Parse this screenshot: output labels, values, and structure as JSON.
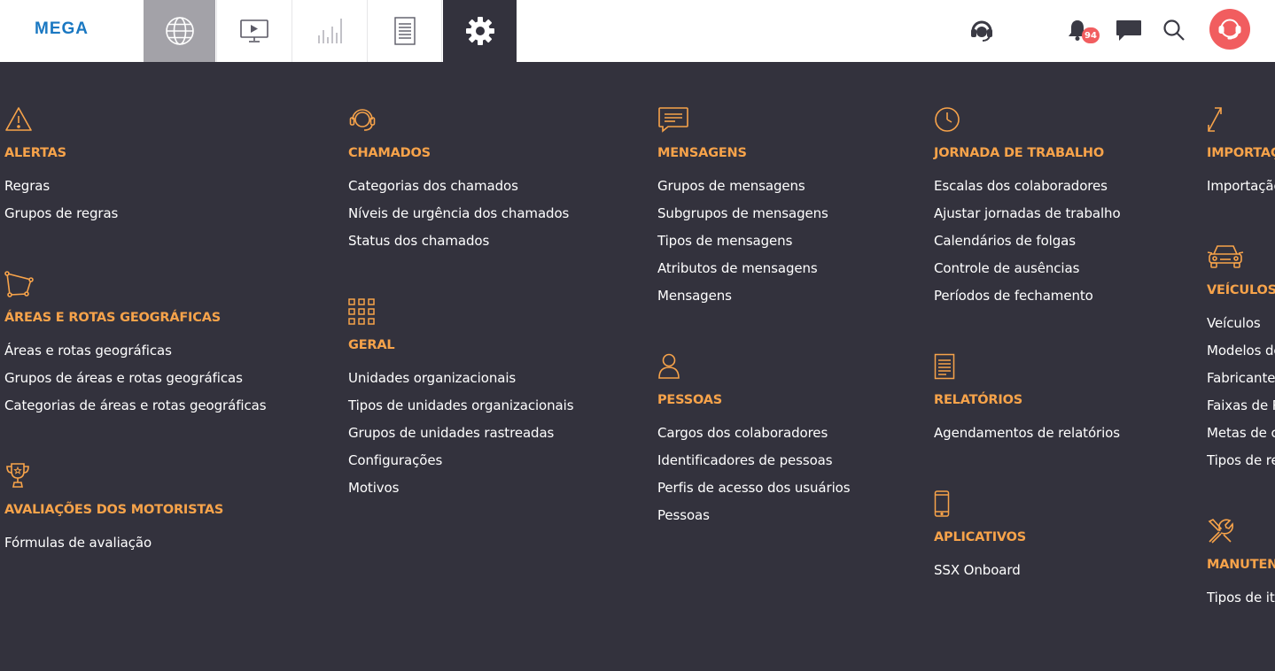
{
  "app": {
    "logo_text": "MEGA"
  },
  "nav": {
    "tabs": [
      {
        "name": "map",
        "icon": "globe-icon",
        "active": false
      },
      {
        "name": "video",
        "icon": "video-monitor-icon",
        "active": false
      },
      {
        "name": "charts",
        "icon": "bar-chart-icon",
        "active": false
      },
      {
        "name": "reports",
        "icon": "document-icon",
        "active": false
      },
      {
        "name": "settings",
        "icon": "gear-icon",
        "active": true
      }
    ]
  },
  "header_right": {
    "support_icon": "headset-icon",
    "notifications_icon": "bell-icon",
    "notifications_count": "94",
    "messages_icon": "chat-bubble-icon",
    "search_icon": "search-icon",
    "avatar_icon": "headset-user-icon"
  },
  "colors": {
    "background": "#33323d",
    "accent": "#f7a34a",
    "logo_blue": "#1a78c2",
    "badge_red": "#f15d5f",
    "active_tab_gray": "#a3a2a8"
  },
  "menu": {
    "col1": {
      "alertas": {
        "icon": "warning-triangle-icon",
        "heading": "ALERTAS",
        "items": [
          "Regras",
          "Grupos de regras"
        ]
      },
      "areas": {
        "icon": "polygon-icon",
        "heading": "ÁREAS E ROTAS GEOGRÁFICAS",
        "items": [
          "Áreas e rotas geográficas",
          "Grupos de áreas e rotas geográficas",
          "Categorias de áreas e rotas geográficas"
        ]
      },
      "avaliacoes": {
        "icon": "trophy-icon",
        "heading": "AVALIAÇÕES DOS MOTORISTAS",
        "items": [
          "Fórmulas de avaliação"
        ]
      }
    },
    "col2": {
      "chamados": {
        "icon": "headset-icon",
        "heading": "CHAMADOS",
        "items": [
          "Categorias dos chamados",
          "Níveis de urgência dos chamados",
          "Status dos chamados"
        ]
      },
      "geral": {
        "icon": "grid-icon",
        "heading": "GERAL",
        "items": [
          "Unidades organizacionais",
          "Tipos de unidades organizacionais",
          "Grupos de unidades rastreadas",
          "Configurações",
          "Motivos"
        ]
      }
    },
    "col3": {
      "mensagens": {
        "icon": "message-icon",
        "heading": "MENSAGENS",
        "items": [
          "Grupos de mensagens",
          "Subgrupos de mensagens",
          "Tipos de mensagens",
          "Atributos de mensagens",
          "Mensagens"
        ]
      },
      "pessoas": {
        "icon": "person-icon",
        "heading": "PESSOAS",
        "items": [
          "Cargos dos colaboradores",
          "Identificadores de pessoas",
          "Perfis de acesso dos usuários",
          "Pessoas"
        ]
      }
    },
    "col4": {
      "jornada": {
        "icon": "clock-icon",
        "heading": "JORNADA DE TRABALHO",
        "items": [
          "Escalas dos colaboradores",
          "Ajustar jornadas de trabalho",
          "Calendários de folgas",
          "Controle de ausências",
          "Períodos de fechamento"
        ]
      },
      "relatorios": {
        "icon": "document-icon",
        "heading": "RELATÓRIOS",
        "items": [
          "Agendamentos de relatórios"
        ]
      },
      "aplicativos": {
        "icon": "smartphone-icon",
        "heading": "APLICATIVOS",
        "items": [
          "SSX Onboard"
        ]
      }
    },
    "col5": {
      "importacao": {
        "icon": "import-arrows-icon",
        "heading": "IMPORTAÇÃO",
        "items": [
          "Importação"
        ]
      },
      "veiculos": {
        "icon": "car-icon",
        "heading": "VEÍCULOS",
        "items": [
          "Veículos",
          "Modelos de veículos",
          "Fabricantes",
          "Faixas de RPM",
          "Metas de consumo",
          "Tipos de registros"
        ]
      },
      "manutencao": {
        "icon": "tools-icon",
        "heading": "MANUTENÇÃO",
        "items": [
          "Tipos de itens"
        ]
      }
    }
  }
}
